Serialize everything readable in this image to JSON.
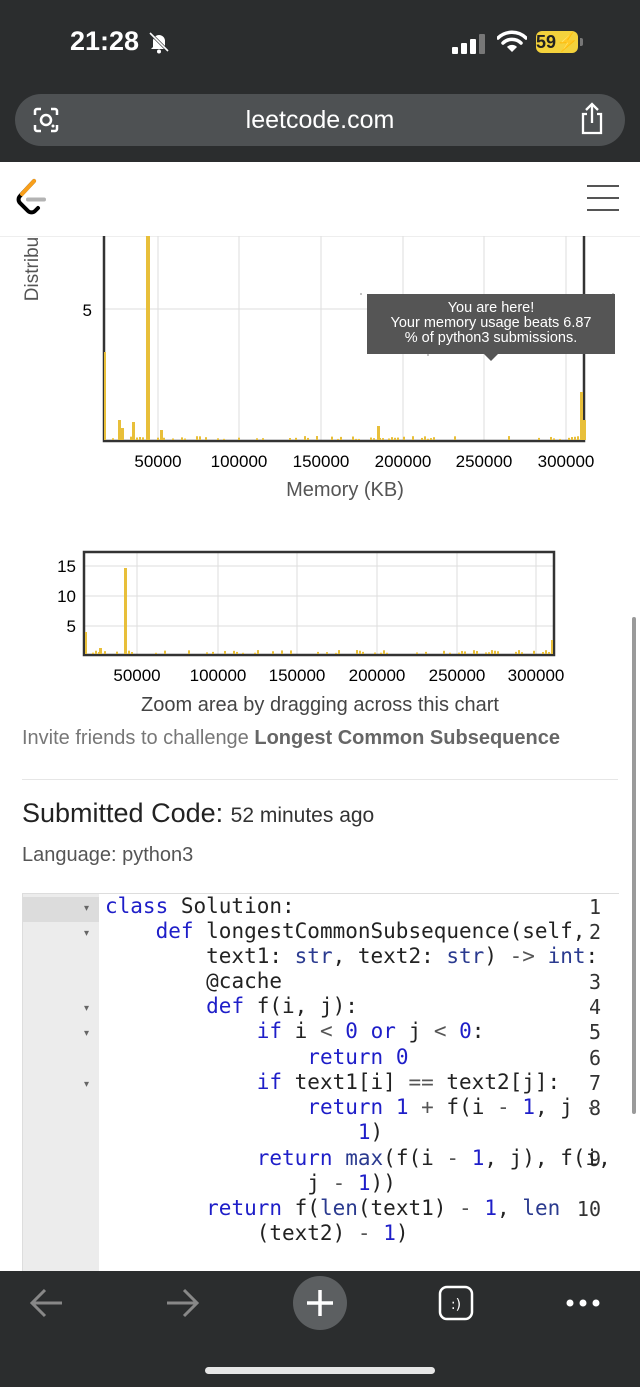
{
  "status_bar": {
    "time": "21:28",
    "battery": "59"
  },
  "browser": {
    "url": "leetcode.com"
  },
  "memory_chart": {
    "y_axis_label": "Distribu",
    "y_tick": "5",
    "x_ticks": [
      "50000",
      "100000",
      "150000",
      "200000",
      "250000",
      "300000"
    ],
    "x_axis_title": "Memory (KB)",
    "tooltip": {
      "line1": "You are here!",
      "line2": "Your memory usage beats 6.87",
      "line3": "% of python3 submissions."
    },
    "accent_color": "#e8bf3a"
  },
  "overview_chart": {
    "y_ticks": [
      "15",
      "10",
      "5"
    ],
    "x_ticks": [
      "50000",
      "100000",
      "150000",
      "200000",
      "250000",
      "300000"
    ],
    "zoom_hint": "Zoom area by dragging across this chart"
  },
  "invite": {
    "prefix": "Invite friends to challenge ",
    "problem": "Longest Common Subsequence"
  },
  "submission": {
    "title": "Submitted Code:",
    "time": "52 minutes ago",
    "language": "Language: python3"
  },
  "code": {
    "line_numbers": [
      "1",
      "2",
      "3",
      "4",
      "5",
      "6",
      "7",
      "8",
      "9",
      "10"
    ]
  }
}
